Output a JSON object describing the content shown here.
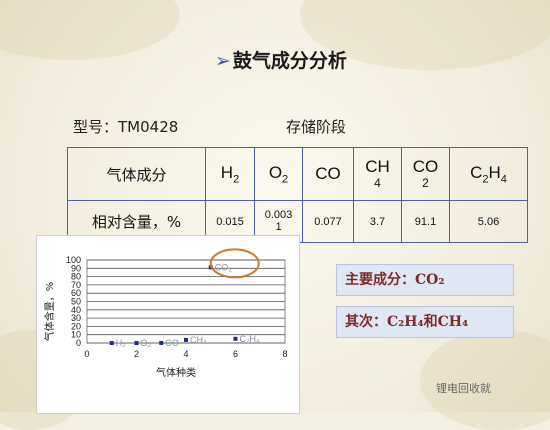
{
  "title": "鼓气成分分析",
  "title_marker": "➢",
  "model": "型号：TM0428",
  "stage": "存储阶段",
  "table": {
    "row_header_1": "气体成分",
    "row_header_2": "相对含量，%",
    "gases": [
      {
        "base": "H",
        "sub": "2"
      },
      {
        "base": "O",
        "sub": "2"
      },
      {
        "base": "CO",
        "sub": ""
      },
      {
        "base": "CH",
        "sub": "4",
        "stacked": true
      },
      {
        "base": "CO",
        "sub": "2",
        "stacked": true
      },
      {
        "base": "C",
        "sub": "2",
        "base2": "H",
        "sub2": "4"
      }
    ],
    "values": [
      "0.015",
      "0.003\n1",
      "0.077",
      "3.7",
      "91.1",
      "5.06"
    ]
  },
  "chart_data": {
    "type": "scatter",
    "ylabel": "气体含量，%",
    "xlabel": "气体种类",
    "xlim": [
      0,
      8
    ],
    "ylim": [
      0,
      100
    ],
    "x_ticks": [
      "0",
      "2",
      "4",
      "6",
      "8"
    ],
    "y_ticks": [
      "0",
      "10",
      "20",
      "30",
      "40",
      "50",
      "60",
      "70",
      "80",
      "90",
      "100"
    ],
    "points": [
      {
        "x": 1,
        "y": 0.015,
        "label": "H₂"
      },
      {
        "x": 2,
        "y": 0.0031,
        "label": "O₂"
      },
      {
        "x": 3,
        "y": 0.077,
        "label": "CO"
      },
      {
        "x": 4,
        "y": 3.7,
        "label": "CH₄"
      },
      {
        "x": 5,
        "y": 91.1,
        "label": "CO₂"
      },
      {
        "x": 6,
        "y": 5.06,
        "label": "C₂H₄"
      }
    ],
    "highlight": "CO₂",
    "colors": {
      "marker": "#1f2f8a",
      "label": "#8a8fb0",
      "highlight": "#c97a2a"
    }
  },
  "boxes": {
    "main": "主要成分：CO₂",
    "secondary": "其次：C₂H₄和CH₄"
  },
  "watermark": "锂电回收就"
}
